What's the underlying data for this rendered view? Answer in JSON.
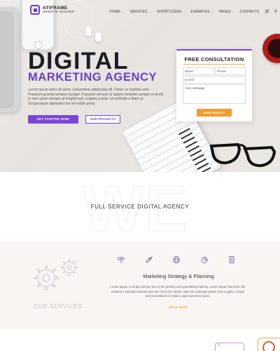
{
  "nav": {
    "logo_name": "ATIFRAME",
    "logo_sub": "WEBSITE BUILDER",
    "items": [
      {
        "label": "HOME"
      },
      {
        "label": "SERVICES"
      },
      {
        "label": "SHORTCODES"
      },
      {
        "label": "EXAMPLES"
      },
      {
        "label": "PAGES"
      },
      {
        "label": "CONTACTS"
      }
    ],
    "cart_icon": "cart-icon",
    "search_icon": "search-icon"
  },
  "hero": {
    "title": "DIGITAL",
    "subtitle": "MARKETING AGENCY",
    "body": "Lorem ipsum dolor sit amet, consectetur adipiscing elit. Donec ac facilisis ante. Praesent gravida tempus suscipit. Praesent vel sem id sapien molestie semper et id elit in sem quam semper at fringilla sed, sodales a ante. Ut molestie a diam ut. Suspendisse dignissim orci vel mollis porta.",
    "primary_button": "GET STARTED NOW!",
    "secondary_button": "OUR PROJECTS"
  },
  "consultation": {
    "title": "FREE CONSULTATION",
    "name_placeholder": "Name",
    "phone_placeholder": "Phone",
    "email_placeholder": "E-mail",
    "message_placeholder": "Your message",
    "submit_label": "SEND REQUEST"
  },
  "agency": {
    "watermark": "WE",
    "title": "FULL SERVICE DIGITAL AGENCY"
  },
  "services": {
    "label": "OUR SERVICES",
    "icons": [
      "signpost-icon",
      "rocket-icon",
      "globe-icon",
      "pie-chart-icon",
      "document-icon"
    ],
    "title": "Marketing Strategy & Planning",
    "body": "Lorem Ipsum is simply dummy text of the printing and typesetting industry. Lorem Ipsum has been the industry's standard dummy text ever since the 1500s, when an unknown printer took a galley of type and scrambled it to make a type specimen book.",
    "read_more": "READ MORE"
  },
  "colors": {
    "accent_purple": "#7b46d6",
    "accent_orange": "#f39c2b"
  }
}
